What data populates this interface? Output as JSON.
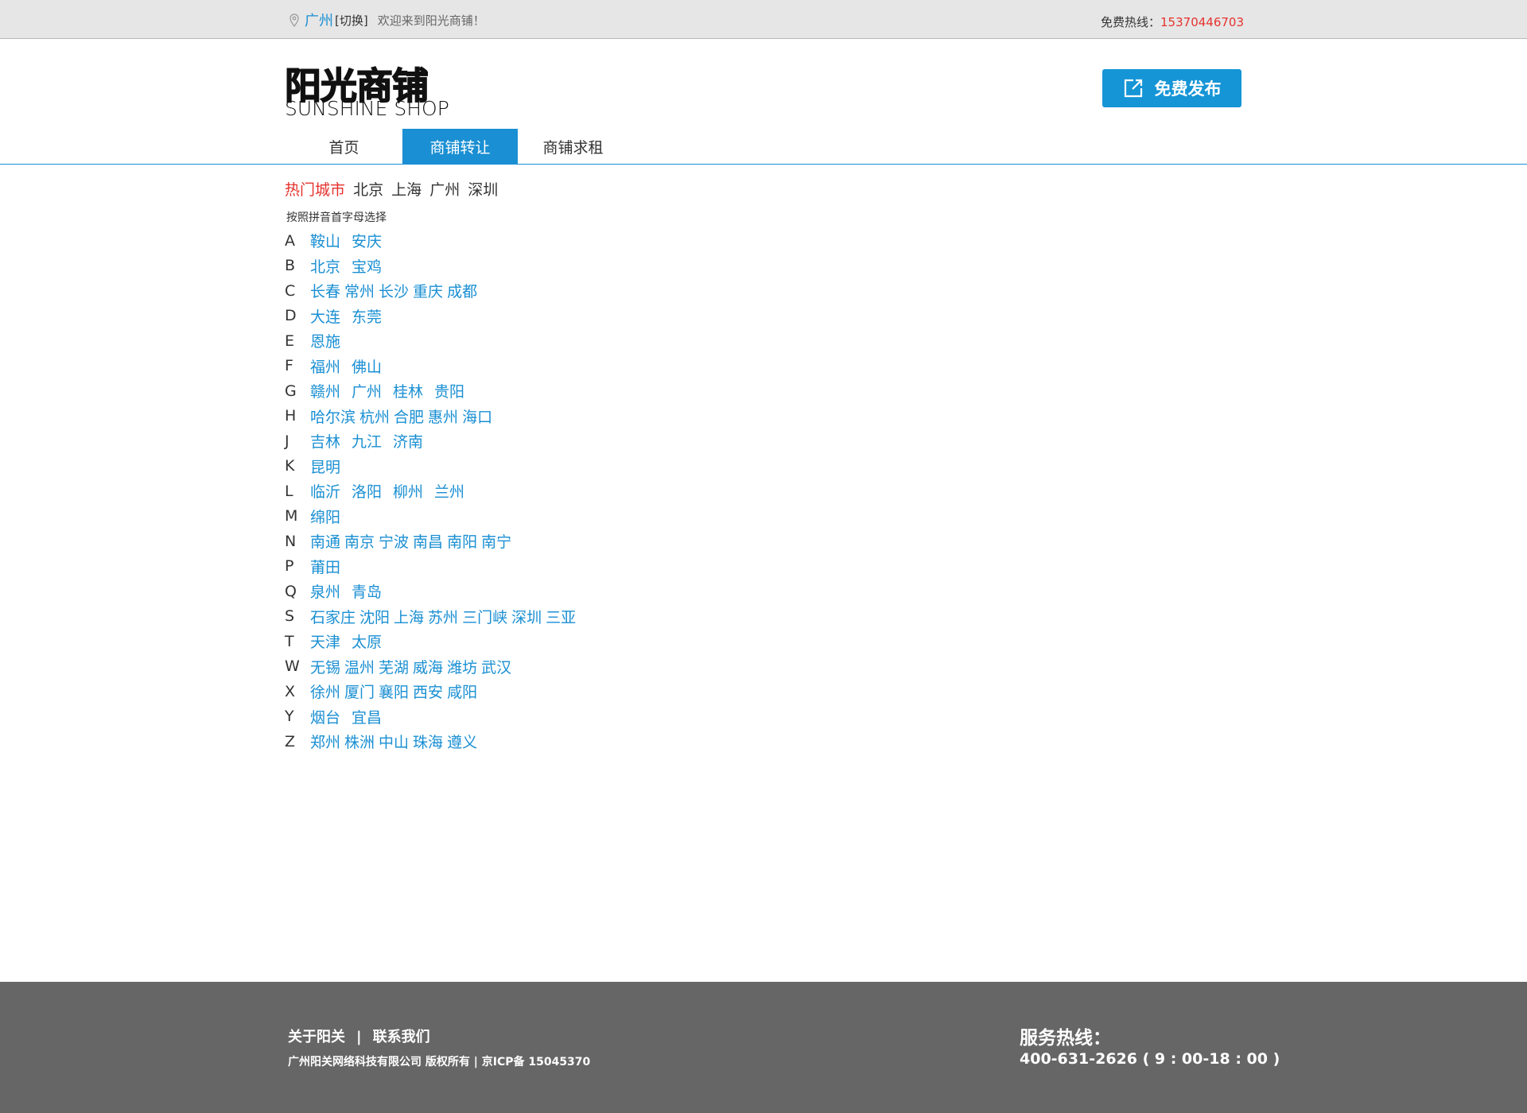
{
  "topbar": {
    "city": "广州",
    "switch_label": "[切换]",
    "welcome": "欢迎来到阳光商铺！",
    "hotline_label": "免费热线：",
    "hotline_number": "15370446703"
  },
  "header": {
    "logo_cn": "阳光商铺",
    "logo_en": "SUNSHINE SHOP",
    "publish_label": "免费发布"
  },
  "nav": {
    "items": [
      "首页",
      "商铺转让",
      "商铺求租"
    ],
    "active": "商铺转让"
  },
  "hot_cities": {
    "label": "热门城市",
    "cities": [
      "北京",
      "上海",
      "广州",
      "深圳"
    ]
  },
  "pinyin_tip": "按照拼音首字母选择",
  "letter_groups": [
    {
      "letter": "A",
      "cities": [
        "鞍山",
        "安庆"
      ]
    },
    {
      "letter": "B",
      "cities": [
        "北京",
        "宝鸡"
      ]
    },
    {
      "letter": "C",
      "cities": [
        "长春",
        "常州",
        "长沙",
        "重庆",
        "成都"
      ]
    },
    {
      "letter": "D",
      "cities": [
        "大连",
        "东莞"
      ]
    },
    {
      "letter": "E",
      "cities": [
        "恩施"
      ]
    },
    {
      "letter": "F",
      "cities": [
        "福州",
        "佛山"
      ]
    },
    {
      "letter": "G",
      "cities": [
        "赣州",
        "广州",
        "桂林",
        "贵阳"
      ]
    },
    {
      "letter": "H",
      "cities": [
        "哈尔滨",
        "杭州",
        "合肥",
        "惠州",
        "海口"
      ]
    },
    {
      "letter": "J",
      "cities": [
        "吉林",
        "九江",
        "济南"
      ]
    },
    {
      "letter": "K",
      "cities": [
        "昆明"
      ]
    },
    {
      "letter": "L",
      "cities": [
        "临沂",
        "洛阳",
        "柳州",
        "兰州"
      ]
    },
    {
      "letter": "M",
      "cities": [
        "绵阳"
      ]
    },
    {
      "letter": "N",
      "cities": [
        "南通",
        "南京",
        "宁波",
        "南昌",
        "南阳",
        "南宁"
      ]
    },
    {
      "letter": "P",
      "cities": [
        "莆田"
      ]
    },
    {
      "letter": "Q",
      "cities": [
        "泉州",
        "青岛"
      ]
    },
    {
      "letter": "S",
      "cities": [
        "石家庄",
        "沈阳",
        "上海",
        "苏州",
        "三门峡",
        "深圳",
        "三亚"
      ]
    },
    {
      "letter": "T",
      "cities": [
        "天津",
        "太原"
      ]
    },
    {
      "letter": "W",
      "cities": [
        "无锡",
        "温州",
        "芜湖",
        "威海",
        "潍坊",
        "武汉"
      ]
    },
    {
      "letter": "X",
      "cities": [
        "徐州",
        "厦门",
        "襄阳",
        "西安",
        "咸阳"
      ]
    },
    {
      "letter": "Y",
      "cities": [
        "烟台",
        "宜昌"
      ]
    },
    {
      "letter": "Z",
      "cities": [
        "郑州",
        "株洲",
        "中山",
        "珠海",
        "遵义"
      ]
    }
  ],
  "footer": {
    "about": "关于阳关",
    "separator": "|",
    "contact": "联系我们",
    "copyright": "广州阳关网络科技有限公司 版权所有 | 京ICP备 15045370",
    "service_title": "服务热线：",
    "service_tel": "400-631-2626 ( 9 : 00-18 : 00 )"
  },
  "colors": {
    "accent_blue": "#1a8fd3",
    "button_blue": "#1595d6",
    "red": "#e5322d",
    "footer_bg": "#666666",
    "topbar_bg": "#e6e6e6"
  }
}
